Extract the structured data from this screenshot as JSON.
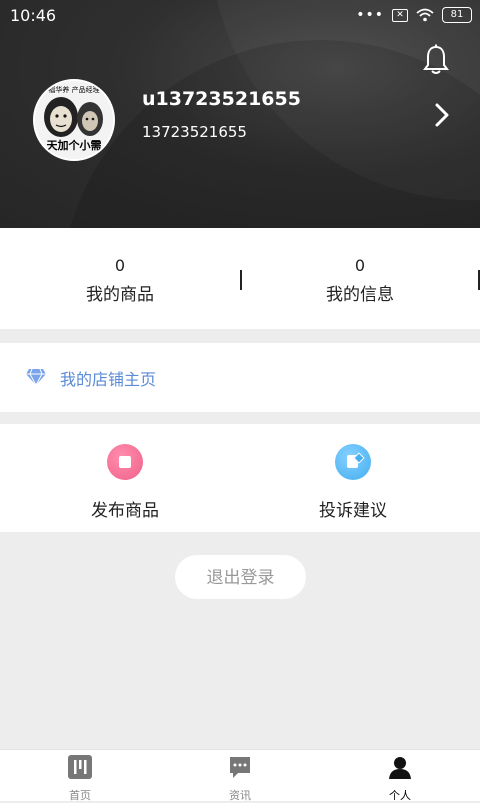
{
  "status_bar": {
    "time": "10:46",
    "dots": "•••",
    "battery": "81"
  },
  "profile": {
    "username": "u13723521655",
    "phone": "13723521655",
    "avatar_top_caption": "福华养   产品经理",
    "avatar_bottom_caption": "天加个小需"
  },
  "stats": [
    {
      "count": "0",
      "label": "我的商品"
    },
    {
      "count": "0",
      "label": "我的信息"
    }
  ],
  "shop_link": {
    "label": "我的店铺主页"
  },
  "actions": [
    {
      "label": "发布商品",
      "color": "#f0608a"
    },
    {
      "label": "投诉建议",
      "color": "#43aef0"
    }
  ],
  "logout_label": "退出登录",
  "tabs": [
    {
      "label": "首页",
      "active": false
    },
    {
      "label": "资讯",
      "active": false
    },
    {
      "label": "个人",
      "active": true
    }
  ],
  "colors": {
    "header_bg": "#2f2f2f",
    "accent_link": "#5a8ad8",
    "page_bg": "#ededed"
  }
}
